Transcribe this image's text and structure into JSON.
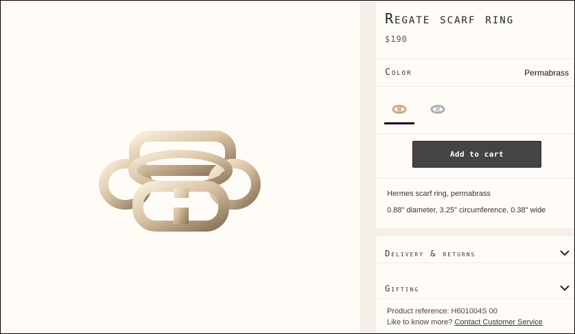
{
  "product": {
    "title": "Regate scarf ring",
    "price": "$190"
  },
  "color": {
    "label": "Color",
    "value": "Permabrass",
    "swatches": [
      {
        "name": "Permabrass",
        "hex": "#d7b98e",
        "selected": true
      },
      {
        "name": "Palladium",
        "hex": "#c9ccce",
        "selected": false
      }
    ]
  },
  "cart": {
    "button_label": "Add to cart"
  },
  "description": {
    "line1": "Hermes scarf ring, permabrass",
    "line2": "0.88\" diameter, 3.25\" circumference, 0.38\" wide"
  },
  "accordion": [
    {
      "label": "Delivery & returns"
    },
    {
      "label": "Gifting"
    }
  ],
  "reference": {
    "text": "Product reference:  H601004S 00",
    "know_prefix": "Like to know more?",
    "contact_link": "Contact Customer Service"
  },
  "colors": {
    "background": "#fffcf7",
    "gutter": "#f4efe7",
    "button": "#444444",
    "ring_gold": "#d9c3a3"
  }
}
